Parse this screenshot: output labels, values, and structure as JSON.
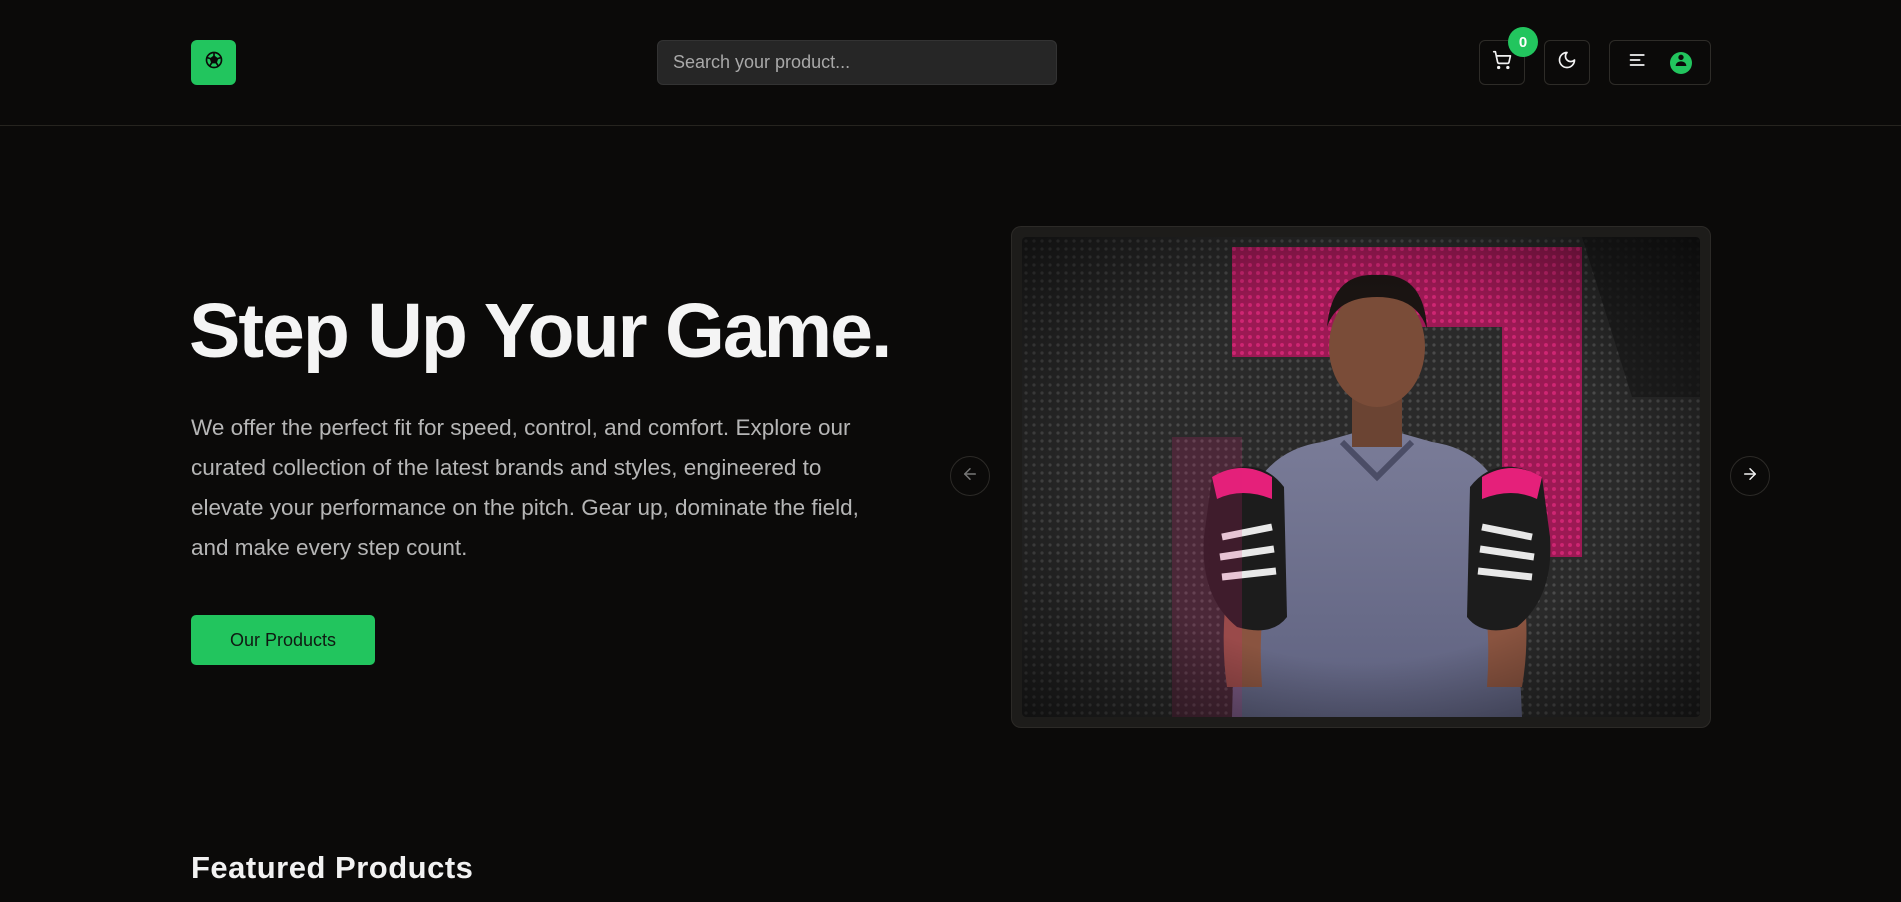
{
  "colors": {
    "accent": "#22c55e",
    "background": "#0b0a09",
    "surface": "#262626",
    "muted_text": "#b6b6b6",
    "promo_magenta": "#e5207a"
  },
  "header": {
    "logo_icon": "soccer-ball-icon",
    "search": {
      "placeholder": "Search your product...",
      "value": ""
    },
    "cart": {
      "icon": "cart-icon",
      "count": "0"
    },
    "theme_toggle": {
      "icon": "moon-icon"
    },
    "user_menu": {
      "menu_icon": "menu-lines-icon",
      "avatar_icon": "user-icon"
    }
  },
  "hero": {
    "title": "Step Up Your Game.",
    "description": "We offer the perfect fit for speed, control, and comfort. Explore our curated collection of the latest brands and styles, engineered to elevate your performance on the pitch. Gear up, dominate the field, and make every step count.",
    "cta_label": "Our Products"
  },
  "carousel": {
    "prev_icon": "arrow-left-icon",
    "next_icon": "arrow-right-icon",
    "slide_subject": "player-holding-pink-black-football-boots"
  },
  "featured": {
    "title": "Featured Products"
  }
}
